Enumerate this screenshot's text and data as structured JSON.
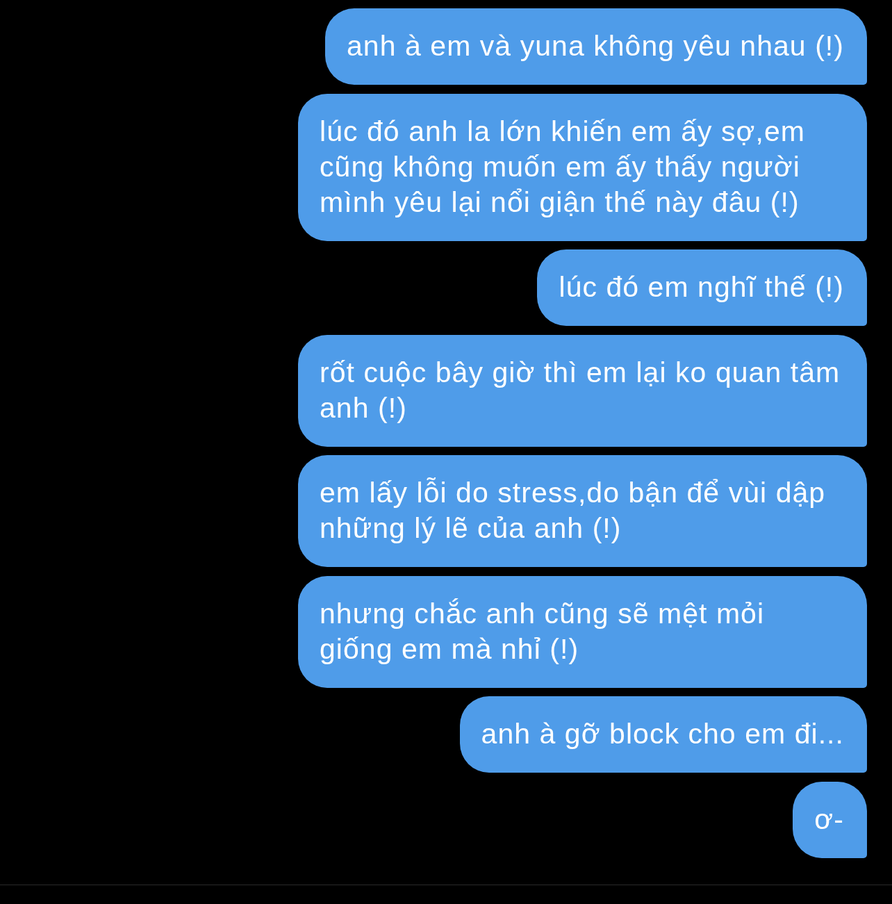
{
  "messages": [
    {
      "text": "anh à em và yuna không yêu nhau (!)"
    },
    {
      "text": "lúc đó anh la lớn khiến em ấy sợ,em cũng không muốn em ấy thấy người mình yêu lại nổi giận thế này đâu (!)"
    },
    {
      "text": "lúc đó em nghĩ thế (!)"
    },
    {
      "text": "rốt cuộc bây giờ thì em lại ko quan tâm anh (!)"
    },
    {
      "text": "em lấy lỗi do stress,do bận để vùi dập những lý lẽ của anh (!)"
    },
    {
      "text": "nhưng chắc anh cũng sẽ mệt mỏi giống em mà nhỉ (!)"
    },
    {
      "text": "anh à gỡ block cho em đi..."
    },
    {
      "text": "ơ-"
    }
  ]
}
